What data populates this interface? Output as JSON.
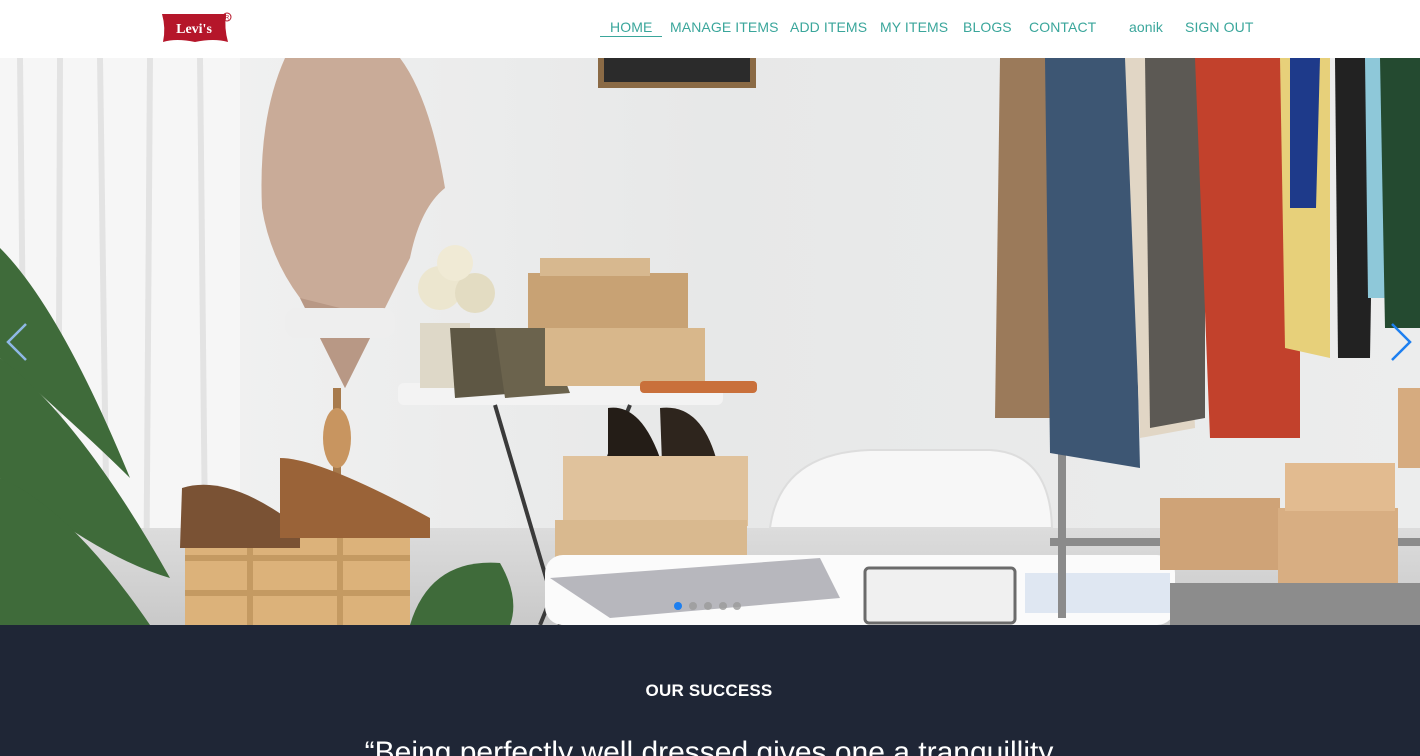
{
  "brand": {
    "logo_text": "Levi's",
    "logo_color": "#b5162a"
  },
  "nav": {
    "items": [
      {
        "label": "HOME",
        "active": true
      },
      {
        "label": "MANAGE ITEMS"
      },
      {
        "label": "ADD ITEMS"
      },
      {
        "label": "MY ITEMS"
      },
      {
        "label": "BLOGS"
      },
      {
        "label": "CONTACT"
      }
    ],
    "user": "aonik",
    "sign_out": "SIGN OUT",
    "link_color": "#3aa69b"
  },
  "hero": {
    "prev_icon": "chevron-left-icon",
    "next_icon": "chevron-right-icon",
    "slide_count": 5,
    "active_slide": 1,
    "dot_active_color": "#1d7ff0"
  },
  "success": {
    "title": "OUR SUCCESS",
    "quote": "“Being perfectly well dressed gives one a tranquillity",
    "background": "#1f2636"
  }
}
